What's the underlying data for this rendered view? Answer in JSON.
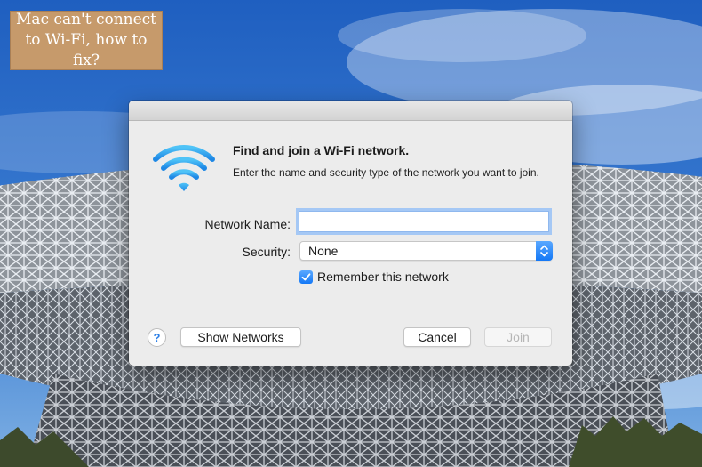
{
  "caption": {
    "line1": "Mac can't connect",
    "line2": "to Wi-Fi, how to fix?"
  },
  "dialog": {
    "icon": "wifi-icon",
    "heading": "Find and join a Wi-Fi network.",
    "subtext": "Enter the name and security type of the network you want to join.",
    "network_name_label": "Network Name:",
    "network_name_value": "",
    "security_label": "Security:",
    "security_value": "None",
    "remember_label": "Remember this network",
    "remember_checked": true,
    "help_label": "?",
    "show_networks_label": "Show Networks",
    "cancel_label": "Cancel",
    "join_label": "Join"
  },
  "colors": {
    "accent": "#1a7cf6",
    "caption_bg": "#c69a6b",
    "dialog_bg": "#ececec",
    "sky": "#2f6fc9"
  }
}
